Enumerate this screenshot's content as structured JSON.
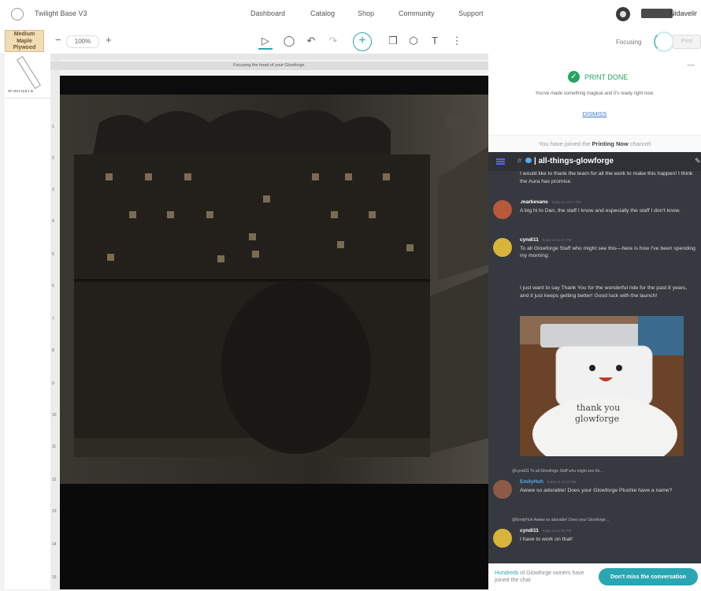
{
  "app": {
    "title": "Twilight Base V3",
    "username": "Nidavelir"
  },
  "nav": {
    "items": [
      "Dashboard",
      "Catalog",
      "Shop",
      "Community",
      "Support"
    ]
  },
  "toolbar": {
    "material": [
      "Medium",
      "Maple",
      "Plywood"
    ],
    "zoom_minus": "−",
    "zoom_value": "100%",
    "zoom_plus": "+",
    "tools": {
      "select": "▷",
      "pan": "◯",
      "undo": "↶",
      "redo": "↷",
      "add": "+",
      "copy": "❐",
      "shapes": "⬡",
      "text": "T",
      "more": "⋮"
    },
    "focusing": "Focusing",
    "print": "Print"
  },
  "thumbnail": {
    "label": "NF BS1 NdL1 tk"
  },
  "canvas": {
    "focus_message": "Focusing the head of your Glowforge.",
    "ruler_ticks": [
      "1",
      "2",
      "3",
      "4",
      "5",
      "6",
      "7",
      "8",
      "9",
      "10",
      "11",
      "12",
      "13",
      "14",
      "15"
    ]
  },
  "print_done": {
    "hide": "HIDE",
    "title": "PRINT DONE",
    "message": "You've made something magical and it's ready right now.",
    "dismiss": "DISMISS"
  },
  "joined": {
    "prefix": "You have joined the ",
    "channel": "Printing Now",
    "suffix": " channel"
  },
  "chat": {
    "hash": "#",
    "channel": "| all-things-glowforge",
    "messages": [
      {
        "name": "",
        "time": "",
        "text": "I would like to thank the team for all the work to make this happen! I think the Aura has promise."
      },
      {
        "name": ".markevans",
        "time": "Today at 12:27 PM",
        "text": "A big hi to Dan, the staff I know and especially the staff I don't know."
      },
      {
        "name": "cyndi11",
        "time": "Today at 12:27 PM",
        "text": "To all Glowforge Staff who might see this—here is how I've been spending my morning:"
      },
      {
        "name": "",
        "time": "",
        "text": "I just want to say Thank You for the wonderful ride for the past 8 years, and it just keeps getting better! Good luck with the launch!"
      },
      {
        "name": "EmilyHuh",
        "time": "Today at 12:29 PM",
        "text": "Awww so adorable! Does your Glowforge Plushie have a name?"
      },
      {
        "name": "cyndi11",
        "time": "Today at 12:29 PM",
        "text": "I have to work on that!"
      }
    ],
    "reply_1": "@cyndi11 To all Glowforge Staff who might see thi...",
    "reply_2": "@EmilyHuh Awww so adorable! Does your Glowforge...",
    "image_text": [
      "thank you",
      "glowforge"
    ]
  },
  "cta": {
    "highlight": "Hundreds",
    "text": " of Glowforge owners have joined the chat",
    "button": "Don't miss the conversation"
  }
}
